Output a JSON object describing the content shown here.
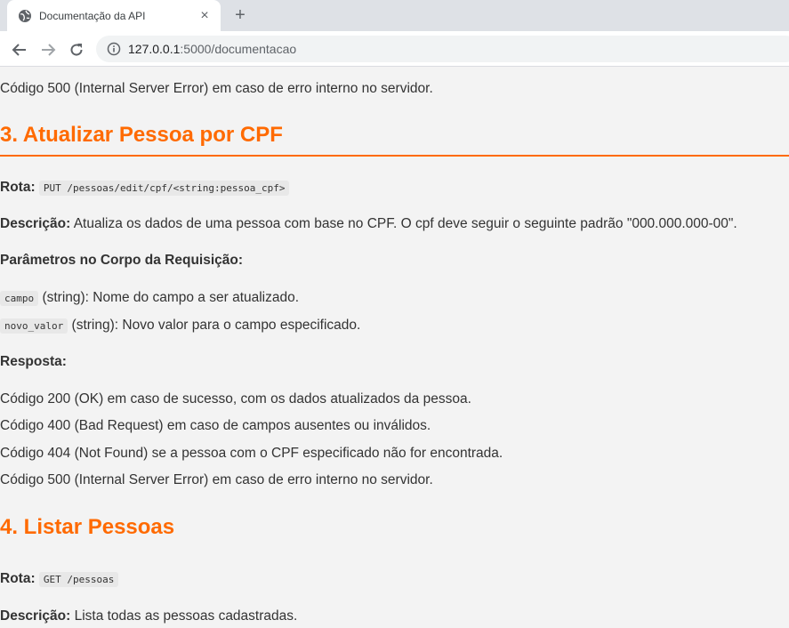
{
  "browser": {
    "tab_title": "Documentação da API",
    "new_tab": "+",
    "close": "×",
    "url_host": "127.0.0.1",
    "url_path": ":5000/documentacao"
  },
  "content": {
    "top_line": "Código 500 (Internal Server Error) em caso de erro interno no servidor.",
    "section3": {
      "title": "3. Atualizar Pessoa por CPF",
      "route_label": "Rota:",
      "route": "PUT /pessoas/edit/cpf/<string:pessoa_cpf>",
      "desc_label": "Descrição:",
      "desc": "Atualiza os dados de uma pessoa com base no CPF. O cpf deve seguir o seguinte padrão \"000.000.000-00\".",
      "params_label": "Parâmetros no Corpo da Requisição:",
      "params": [
        {
          "name": "campo",
          "text": "(string): Nome do campo a ser atualizado."
        },
        {
          "name": "novo_valor",
          "text": "(string): Novo valor para o campo especificado."
        }
      ],
      "response_label": "Resposta:",
      "responses": [
        "Código 200 (OK) em caso de sucesso, com os dados atualizados da pessoa.",
        "Código 400 (Bad Request) em caso de campos ausentes ou inválidos.",
        "Código 404 (Not Found) se a pessoa com o CPF especificado não for encontrada.",
        "Código 500 (Internal Server Error) em caso de erro interno no servidor."
      ]
    },
    "section4": {
      "title": "4. Listar Pessoas",
      "route_label": "Rota:",
      "route": "GET /pessoas",
      "desc_label": "Descrição:",
      "desc": "Lista todas as pessoas cadastradas."
    }
  },
  "colors": {
    "accent": "#ff6a00",
    "background": "#f3f3f3"
  }
}
